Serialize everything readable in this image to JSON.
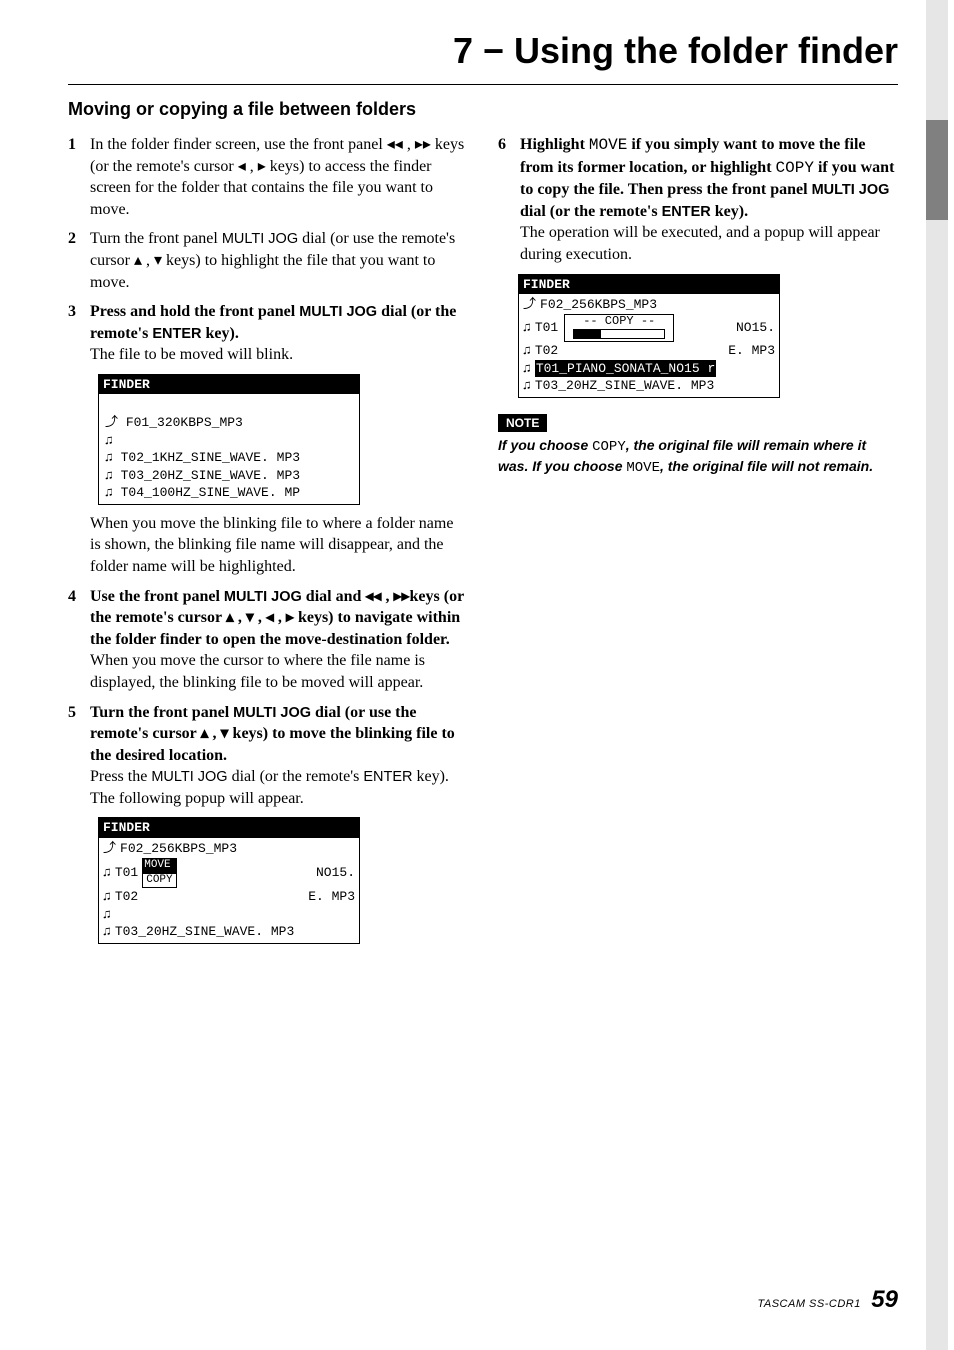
{
  "chapter_title": "7 − Using the folder finder",
  "section_heading": "Moving or copying a file between folders",
  "glyphs": {
    "rew": "◂◂",
    "ff": "▸▸",
    "left": "◂",
    "right": "▸",
    "up": "▴",
    "down": "▾",
    "note": "♫",
    "folder_up": "⤴"
  },
  "ui": {
    "multi_jog": "MULTI JOG",
    "enter": "ENTER"
  },
  "mono_words": {
    "move": "MOVE",
    "copy": "COPY"
  },
  "steps_left": {
    "s1": {
      "num": "1",
      "t1": "In the folder finder screen, use the front panel ",
      "t2": " , ",
      "t3": " keys (or the remote's cursor ",
      "t4": " , ",
      "t5": " keys) to access the finder screen for the folder that contains the file you want to move."
    },
    "s2": {
      "num": "2",
      "t1": "Turn the front panel ",
      "t2": " dial (or use the remote's cursor ",
      "t3": " , ",
      "t4": " keys) to highlight the file that you want to move."
    },
    "s3": {
      "num": "3",
      "t1": "Press and hold the front panel ",
      "t2": " dial (or the remote's ",
      "t3": " key).",
      "sub": "The file to be moved will blink."
    },
    "s3_after": "When you move the blinking file to where a folder name is shown, the blinking file name will disappear, and the folder name will be highlighted.",
    "s4": {
      "num": "4",
      "t1": "Use the front panel ",
      "t2": " dial and ",
      "t3": " , ",
      "t4": "keys (or the remote's cursor ",
      "t5": " , ",
      "t6": " , ",
      "t7": " , ",
      "t8": " keys) to navigate within the folder finder to open the move-destination folder.",
      "sub": "When you move the cursor to where the file name is displayed, the blinking file to be moved will appear."
    },
    "s5": {
      "num": "5",
      "t1": "Turn the front panel ",
      "t2": " dial (or use the remote's cursor ",
      "t3": " , ",
      "t4": " keys) to move the blinking file to the desired location.",
      "sub1": "Press the ",
      "sub2": " dial (or the remote's ",
      "sub3": " key). The following popup will appear."
    }
  },
  "steps_right": {
    "s6": {
      "num": "6",
      "t1": "Highlight ",
      "t2": " if you simply want to move the file from its former location, or highlight ",
      "t3": " if you want to copy the file. Then press the front panel ",
      "t4": " dial (or the remote's ",
      "t5": " key).",
      "sub": "The operation will be executed, and a popup will appear during execution."
    }
  },
  "note": {
    "label": "NOTE",
    "t1": "If you choose ",
    "t2": ", the original file will remain where it was. If you choose ",
    "t3": ", the original file will not remain."
  },
  "lcd1": {
    "header": "FINDER",
    "l1": "F01_320KBPS_MP3",
    "l2": "",
    "l3": "T02_1KHZ_SINE_WAVE. MP3",
    "l4": "T03_20HZ_SINE_WAVE. MP3",
    "l5": "T04_100HZ_SINE_WAVE. MP"
  },
  "lcd2": {
    "header": "FINDER",
    "l1": "F02_256KBPS_MP3",
    "row2_a": "T01",
    "row2_opt1": "MOVE",
    "row2_b": "NO15.",
    "row3_a": "T02",
    "row3_opt2": "COPY",
    "row3_b": "E. MP3",
    "l4": "",
    "l5": "T03_20HZ_SINE_WAVE. MP3"
  },
  "lcd3": {
    "header": "FINDER",
    "l1": "F02_256KBPS_MP3",
    "row2_a": "T01",
    "row2_mid": "-- COPY --",
    "row2_b": "NO15.",
    "row3_a": "T02",
    "row3_b": "E. MP3",
    "l4": "T01_PIANO_SONATA_NO15 r",
    "l5": "T03_20HZ_SINE_WAVE. MP3"
  },
  "footer": {
    "brand": "TASCAM  SS-CDR1",
    "page": "59"
  }
}
